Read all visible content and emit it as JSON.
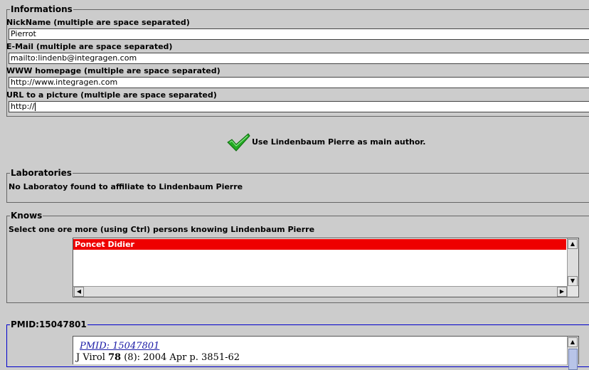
{
  "informations": {
    "legend": "Informations",
    "nickname_label": "NickName (multiple are space separated)",
    "nickname_value": "Pierrot",
    "email_label": "E-Mail (multiple are space separated)",
    "email_value": "mailto:lindenb@integragen.com",
    "www_label": "WWW homepage (multiple are space separated)",
    "www_value": "http://www.integragen.com",
    "picture_label": "URL to a picture  (multiple are space separated)",
    "picture_value": "http://"
  },
  "main_author": {
    "icon": "checkmark-icon",
    "text": "Use Lindenbaum Pierre as main author.",
    "icon_color": "#22aa22"
  },
  "laboratories": {
    "legend": "Laboratories",
    "message": "No Laboratoy found to affiliate to Lindenbaum Pierre"
  },
  "knows": {
    "legend": "Knows",
    "instruction": "Select one ore more (using Ctrl) persons knowing Lindenbaum Pierre",
    "items": [
      "Poncet Didier"
    ],
    "selected_color": "#ee0000"
  },
  "publication": {
    "legend": "PMID:15047801",
    "link": "PMID: 15047801",
    "journal": "J Virol ",
    "volume": "78",
    "rest": " (8): 2004 Apr p. 3851-62",
    "border_color": "#0000cc"
  }
}
